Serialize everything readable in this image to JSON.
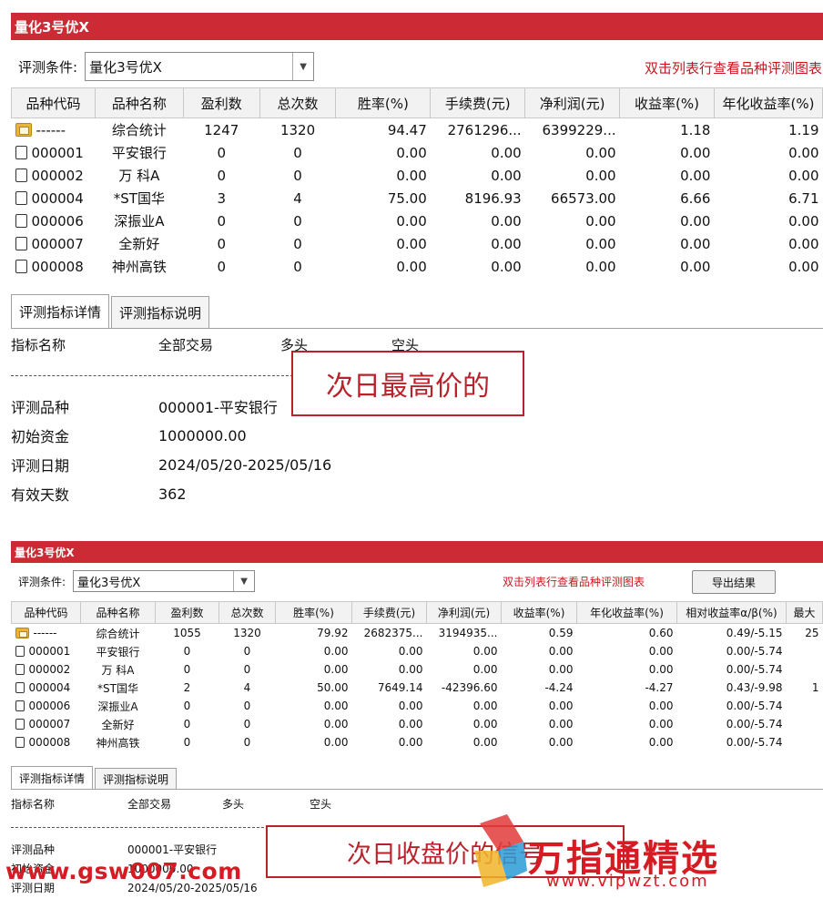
{
  "panel1": {
    "title": "量化3号优X",
    "condition_label": "评测条件:",
    "condition_value": "量化3号优X",
    "hint": "双击列表行查看品种评测图表",
    "columns": [
      "品种代码",
      "品种名称",
      "盈利数",
      "总次数",
      "胜率(%)",
      "手续费(元)",
      "净利润(元)",
      "收益率(%)",
      "年化收益率(%)"
    ],
    "rows": [
      {
        "code": "------",
        "name": "综合统计",
        "win": "1247",
        "total": "1320",
        "rate": "94.47",
        "fee": "2761296...",
        "profit": "6399229...",
        "ret": "1.18",
        "annual": "1.19",
        "icon": "folder"
      },
      {
        "code": "000001",
        "name": "平安银行",
        "win": "0",
        "total": "0",
        "rate": "0.00",
        "fee": "0.00",
        "profit": "0.00",
        "ret": "0.00",
        "annual": "0.00",
        "icon": "doc"
      },
      {
        "code": "000002",
        "name": "万 科A",
        "win": "0",
        "total": "0",
        "rate": "0.00",
        "fee": "0.00",
        "profit": "0.00",
        "ret": "0.00",
        "annual": "0.00",
        "icon": "doc"
      },
      {
        "code": "000004",
        "name": "*ST国华",
        "win": "3",
        "total": "4",
        "rate": "75.00",
        "fee": "8196.93",
        "profit": "66573.00",
        "ret": "6.66",
        "annual": "6.71",
        "icon": "doc"
      },
      {
        "code": "000006",
        "name": "深振业A",
        "win": "0",
        "total": "0",
        "rate": "0.00",
        "fee": "0.00",
        "profit": "0.00",
        "ret": "0.00",
        "annual": "0.00",
        "icon": "doc"
      },
      {
        "code": "000007",
        "name": "全新好",
        "win": "0",
        "total": "0",
        "rate": "0.00",
        "fee": "0.00",
        "profit": "0.00",
        "ret": "0.00",
        "annual": "0.00",
        "icon": "doc"
      },
      {
        "code": "000008",
        "name": "神州高铁",
        "win": "0",
        "total": "0",
        "rate": "0.00",
        "fee": "0.00",
        "profit": "0.00",
        "ret": "0.00",
        "annual": "0.00",
        "icon": "doc"
      }
    ],
    "tabs": [
      "评测指标详情",
      "评测指标说明"
    ],
    "detail_head": [
      "指标名称",
      "全部交易",
      "多头",
      "空头"
    ],
    "info": [
      {
        "key": "评测品种",
        "value": "000001-平安银行"
      },
      {
        "key": "初始资金",
        "value": "1000000.00"
      },
      {
        "key": "评测日期",
        "value": "2024/05/20-2025/05/16"
      },
      {
        "key": "有效天数",
        "value": "362"
      }
    ],
    "callout": "次日最高价的"
  },
  "panel2": {
    "title": "量化3号优X",
    "condition_label": "评测条件:",
    "condition_value": "量化3号优X",
    "hint": "双击列表行查看品种评测图表",
    "export_label": "导出结果",
    "columns": [
      "品种代码",
      "品种名称",
      "盈利数",
      "总次数",
      "胜率(%)",
      "手续费(元)",
      "净利润(元)",
      "收益率(%)",
      "年化收益率(%)",
      "相对收益率α/β(%)",
      "最大"
    ],
    "rows": [
      {
        "code": "------",
        "name": "综合统计",
        "win": "1055",
        "total": "1320",
        "rate": "79.92",
        "fee": "2682375...",
        "profit": "3194935...",
        "ret": "0.59",
        "annual": "0.60",
        "rel": "0.49/-5.15",
        "max": "25",
        "icon": "folder"
      },
      {
        "code": "000001",
        "name": "平安银行",
        "win": "0",
        "total": "0",
        "rate": "0.00",
        "fee": "0.00",
        "profit": "0.00",
        "ret": "0.00",
        "annual": "0.00",
        "rel": "0.00/-5.74",
        "max": "",
        "icon": "doc"
      },
      {
        "code": "000002",
        "name": "万 科A",
        "win": "0",
        "total": "0",
        "rate": "0.00",
        "fee": "0.00",
        "profit": "0.00",
        "ret": "0.00",
        "annual": "0.00",
        "rel": "0.00/-5.74",
        "max": "",
        "icon": "doc"
      },
      {
        "code": "000004",
        "name": "*ST国华",
        "win": "2",
        "total": "4",
        "rate": "50.00",
        "fee": "7649.14",
        "profit": "-42396.60",
        "ret": "-4.24",
        "annual": "-4.27",
        "rel": "0.43/-9.98",
        "max": "1",
        "icon": "doc"
      },
      {
        "code": "000006",
        "name": "深振业A",
        "win": "0",
        "total": "0",
        "rate": "0.00",
        "fee": "0.00",
        "profit": "0.00",
        "ret": "0.00",
        "annual": "0.00",
        "rel": "0.00/-5.74",
        "max": "",
        "icon": "doc"
      },
      {
        "code": "000007",
        "name": "全新好",
        "win": "0",
        "total": "0",
        "rate": "0.00",
        "fee": "0.00",
        "profit": "0.00",
        "ret": "0.00",
        "annual": "0.00",
        "rel": "0.00/-5.74",
        "max": "",
        "icon": "doc"
      },
      {
        "code": "000008",
        "name": "神州高铁",
        "win": "0",
        "total": "0",
        "rate": "0.00",
        "fee": "0.00",
        "profit": "0.00",
        "ret": "0.00",
        "annual": "0.00",
        "rel": "0.00/-5.74",
        "max": "",
        "icon": "doc"
      }
    ],
    "tabs": [
      "评测指标详情",
      "评测指标说明"
    ],
    "detail_head": [
      "指标名称",
      "全部交易",
      "多头",
      "空头"
    ],
    "info": [
      {
        "key": "评测品种",
        "value": "000001-平安银行"
      },
      {
        "key": "初始资金",
        "value": "1000000.00"
      },
      {
        "key": "评测日期",
        "value": "2024/05/20-2025/05/16"
      }
    ],
    "callout": "次日收盘价的信号"
  },
  "watermark": {
    "left_text": "www.gsw007.com",
    "right_text": "万指通精选",
    "right_sub": "www.vipwzt.com"
  },
  "colors": {
    "titlebar": "#cc2a34",
    "hint": "#c8161d",
    "callout": "#b8232b",
    "watermark": "#d51c24"
  }
}
